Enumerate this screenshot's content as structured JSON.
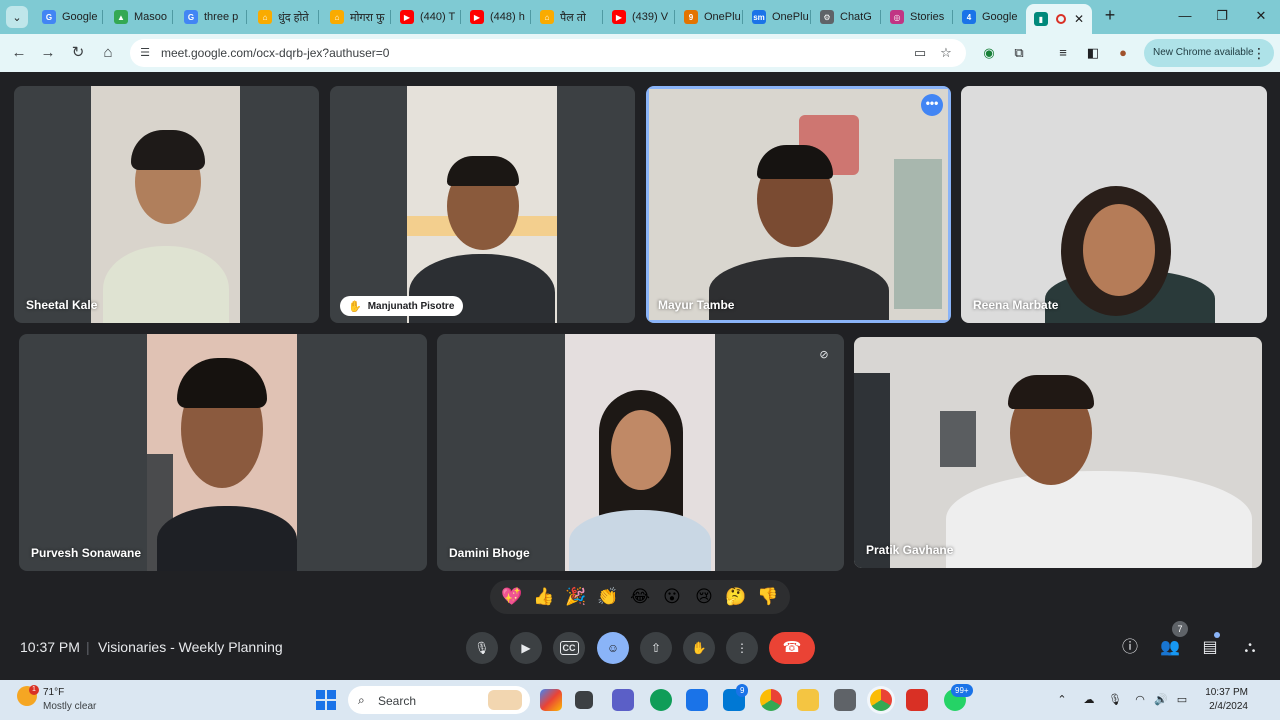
{
  "browser": {
    "tabs": [
      {
        "title": "Google",
        "icon": "google-icon",
        "color": "#4285f4"
      },
      {
        "title": "Masoo",
        "icon": "drive-icon",
        "color": "#34a853"
      },
      {
        "title": "three p",
        "icon": "google-icon",
        "color": "#4285f4"
      },
      {
        "title": "धुंद होते",
        "icon": "site-icon",
        "color": "#f9ab00"
      },
      {
        "title": "मोगरा फु",
        "icon": "site-icon",
        "color": "#f9ab00"
      },
      {
        "title": "(440) T",
        "icon": "youtube-icon",
        "color": "#ff0000"
      },
      {
        "title": "(448) h",
        "icon": "youtube-icon",
        "color": "#ff0000"
      },
      {
        "title": "पैल तो",
        "icon": "site-icon",
        "color": "#f9ab00"
      },
      {
        "title": "(439) V",
        "icon": "youtube-icon",
        "color": "#ff0000"
      },
      {
        "title": "OnePlu",
        "icon": "site-icon",
        "color": "#e37400"
      },
      {
        "title": "OnePlu",
        "icon": "sm-icon",
        "color": "#1a73e8"
      },
      {
        "title": "ChatG",
        "icon": "chatgpt-icon",
        "color": "#5f6368"
      },
      {
        "title": "Stories",
        "icon": "instagram-icon",
        "color": "#c13584"
      },
      {
        "title": "Google",
        "icon": "site-icon",
        "color": "#1a73e8"
      },
      {
        "title": "",
        "icon": "meet-icon",
        "color": "#00897b",
        "active": true
      }
    ],
    "url": "meet.google.com/ocx-dqrb-jex?authuser=0",
    "new_chrome_label": "New Chrome available"
  },
  "participants": [
    {
      "name": "Sheetal Kale"
    },
    {
      "name": "Manjunath Pisotre",
      "hand_raised": true
    },
    {
      "name": "Mayur Tambe",
      "active_speaker": true
    },
    {
      "name": "Reena Marbate"
    },
    {
      "name": "Purvesh Sonawane"
    },
    {
      "name": "Damini Bhoge",
      "muted": true
    },
    {
      "name": "Pratik Gavhane"
    }
  ],
  "reactions": [
    "💖",
    "👍",
    "🎉",
    "👏",
    "😂",
    "😮",
    "😢",
    "🤔",
    "👎"
  ],
  "meeting": {
    "time": "10:37 PM",
    "separator": "|",
    "title": "Visionaries - Weekly Planning",
    "people_count": "7",
    "captions_label": "CC"
  },
  "taskbar": {
    "temperature": "71°F",
    "condition": "Mostly clear",
    "weather_badge": "1",
    "search_placeholder": "Search",
    "mail_badge": "9",
    "whatsapp_badge": "99+",
    "time": "10:37 PM",
    "date": "2/4/2024"
  },
  "colors": {
    "meet_bg": "#202124",
    "tile_bg": "#3c4043",
    "accent_blue": "#8ab4f8",
    "end_call_red": "#ea4335",
    "chrome_theme": "#7fcad3"
  }
}
